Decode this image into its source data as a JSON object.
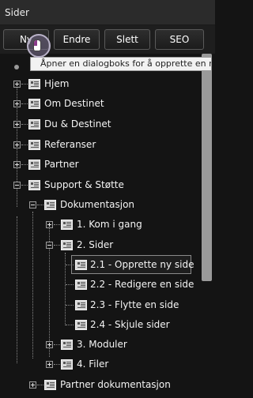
{
  "panel": {
    "title": "Sider"
  },
  "toolbar": {
    "buttons": [
      "Ny",
      "Endre",
      "Slett",
      "SEO"
    ]
  },
  "tooltip": {
    "text": "Åpner en dialogboks for å opprette en ny side"
  },
  "tree": {
    "nodes": [
      {
        "label": "Hjem",
        "expander": "plus"
      },
      {
        "label": "Om Destinet",
        "expander": "plus"
      },
      {
        "label": "Du & Destinet",
        "expander": "plus"
      },
      {
        "label": "Referanser",
        "expander": "plus"
      },
      {
        "label": "Partner",
        "expander": "plus"
      },
      {
        "label": "Support & Støtte",
        "expander": "minus"
      },
      {
        "label": "Dokumentasjon",
        "expander": "minus"
      },
      {
        "label": "1. Kom i gang",
        "expander": "plus"
      },
      {
        "label": "2. Sider",
        "expander": "minus"
      },
      {
        "label": "2.1 - Opprette ny side",
        "expander": "none",
        "selected": true
      },
      {
        "label": "2.2 - Redigere en side",
        "expander": "none"
      },
      {
        "label": "2.3 - Flytte en side",
        "expander": "none"
      },
      {
        "label": "2.4 - Skjule sider",
        "expander": "none"
      },
      {
        "label": "3. Moduler",
        "expander": "plus"
      },
      {
        "label": "4. Filer",
        "expander": "plus"
      },
      {
        "label": "Partner dokumentasjon",
        "expander": "plus"
      }
    ]
  },
  "icons": {
    "page": "page-icon",
    "expand": "expand-icon",
    "collapse": "collapse-icon"
  }
}
